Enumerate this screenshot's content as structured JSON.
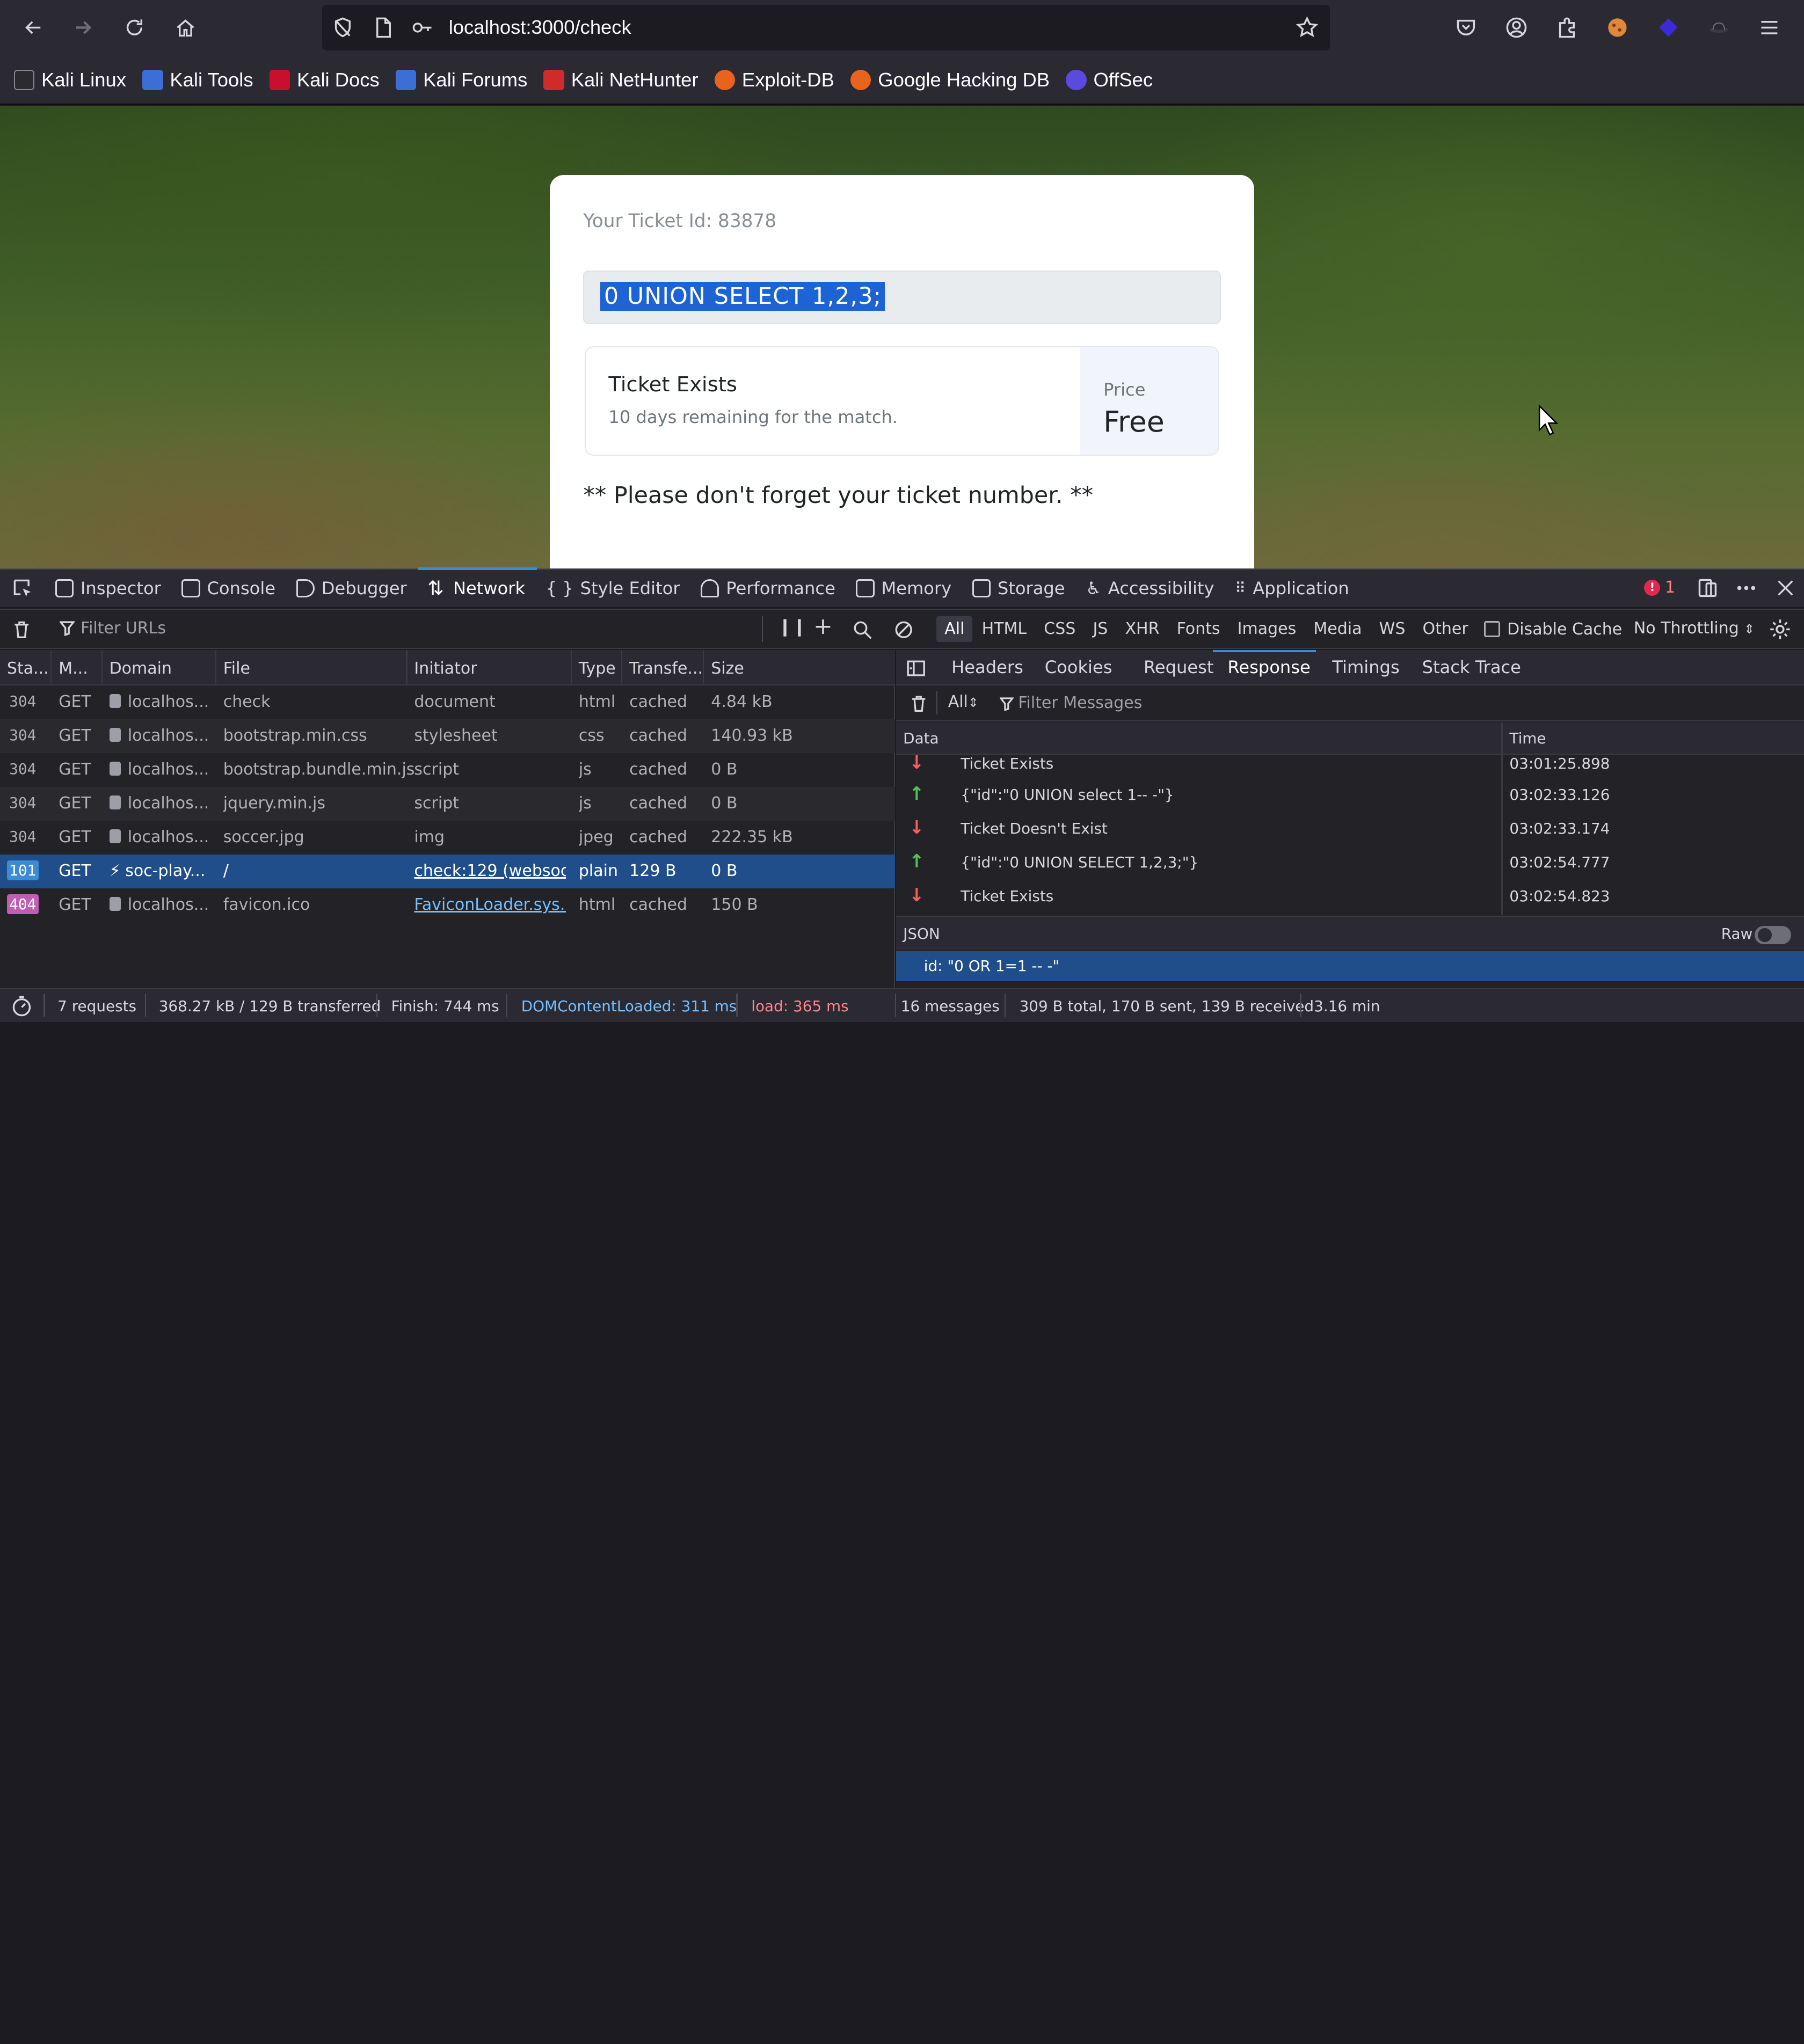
{
  "browser": {
    "url": "localhost:3000/check",
    "bookmarks": [
      "Kali Linux",
      "Kali Tools",
      "Kali Docs",
      "Kali Forums",
      "Kali NetHunter",
      "Exploit-DB",
      "Google Hacking DB",
      "OffSec"
    ]
  },
  "page": {
    "ticket_id_label": "Your Ticket Id: 83878",
    "input_value": "0 UNION SELECT 1,2,3;",
    "result_title": "Ticket Exists",
    "result_subtitle": "10 days remaining for the match.",
    "price_label": "Price",
    "price_value": "Free",
    "note": "** Please don't forget your ticket number. **"
  },
  "devtools": {
    "tabs": [
      "Inspector",
      "Console",
      "Debugger",
      "Network",
      "Style Editor",
      "Performance",
      "Memory",
      "Storage",
      "Accessibility",
      "Application"
    ],
    "active_tab": "Network",
    "error_count": "1",
    "filter_placeholder": "Filter URLs",
    "type_filters": [
      "All",
      "HTML",
      "CSS",
      "JS",
      "XHR",
      "Fonts",
      "Images",
      "Media",
      "WS",
      "Other"
    ],
    "disable_cache_label": "Disable Cache",
    "throttling_label": "No Throttling",
    "columns": [
      "Sta...",
      "M...",
      "Domain",
      "File",
      "Initiator",
      "Type",
      "Transfe...",
      "Size"
    ],
    "requests": [
      {
        "status": "304",
        "method": "GET",
        "domain": "localhos...",
        "file": "check",
        "initiator": "document",
        "type": "html",
        "transferred": "cached",
        "size": "4.84 kB"
      },
      {
        "status": "304",
        "method": "GET",
        "domain": "localhos...",
        "file": "bootstrap.min.css",
        "initiator": "stylesheet",
        "type": "css",
        "transferred": "cached",
        "size": "140.93 kB"
      },
      {
        "status": "304",
        "method": "GET",
        "domain": "localhos...",
        "file": "bootstrap.bundle.min.js",
        "initiator": "script",
        "type": "js",
        "transferred": "cached",
        "size": "0 B"
      },
      {
        "status": "304",
        "method": "GET",
        "domain": "localhos...",
        "file": "jquery.min.js",
        "initiator": "script",
        "type": "js",
        "transferred": "cached",
        "size": "0 B"
      },
      {
        "status": "304",
        "method": "GET",
        "domain": "localhos...",
        "file": "soccer.jpg",
        "initiator": "img",
        "type": "jpeg",
        "transferred": "cached",
        "size": "222.35 kB"
      },
      {
        "status": "101",
        "method": "GET",
        "domain": "soc-play...",
        "file": "/",
        "initiator": "check:129 (websoc...",
        "type": "plain",
        "transferred": "129 B",
        "size": "0 B"
      },
      {
        "status": "404",
        "method": "GET",
        "domain": "localhos...",
        "file": "favicon.ico",
        "initiator": "FaviconLoader.sys....",
        "type": "html",
        "transferred": "cached",
        "size": "150 B"
      }
    ],
    "detail_tabs": [
      "Headers",
      "Cookies",
      "Request",
      "Response",
      "Timings",
      "Stack Trace"
    ],
    "active_detail_tab": "Response",
    "ws_filter_select": "All",
    "ws_filter_placeholder": "Filter Messages",
    "ws_columns": [
      "Data",
      "Time"
    ],
    "messages": [
      {
        "dir": "down",
        "data": "Ticket Exists",
        "time": "03:01:25.898"
      },
      {
        "dir": "up",
        "data": "{\"id\":\"0 UNION select 1-- -\"}",
        "time": "03:02:33.126"
      },
      {
        "dir": "down",
        "data": "Ticket Doesn't Exist",
        "time": "03:02:33.174"
      },
      {
        "dir": "up",
        "data": "{\"id\":\"0 UNION SELECT 1,2,3;\"}",
        "time": "03:02:54.777"
      },
      {
        "dir": "down",
        "data": "Ticket Exists",
        "time": "03:02:54.823"
      }
    ],
    "json_label": "JSON",
    "raw_label": "Raw",
    "json_row": "id: \"0 OR 1=1 -- -\"",
    "status": {
      "requests": "7 requests",
      "transferred": "368.27 kB / 129 B transferred",
      "finish": "Finish: 744 ms",
      "domcontentloaded": "DOMContentLoaded: 311 ms",
      "load": "load: 365 ms",
      "messages": "16 messages",
      "bytes": "309 B total, 170 B sent, 139 B received",
      "duration": "3.16 min"
    }
  }
}
